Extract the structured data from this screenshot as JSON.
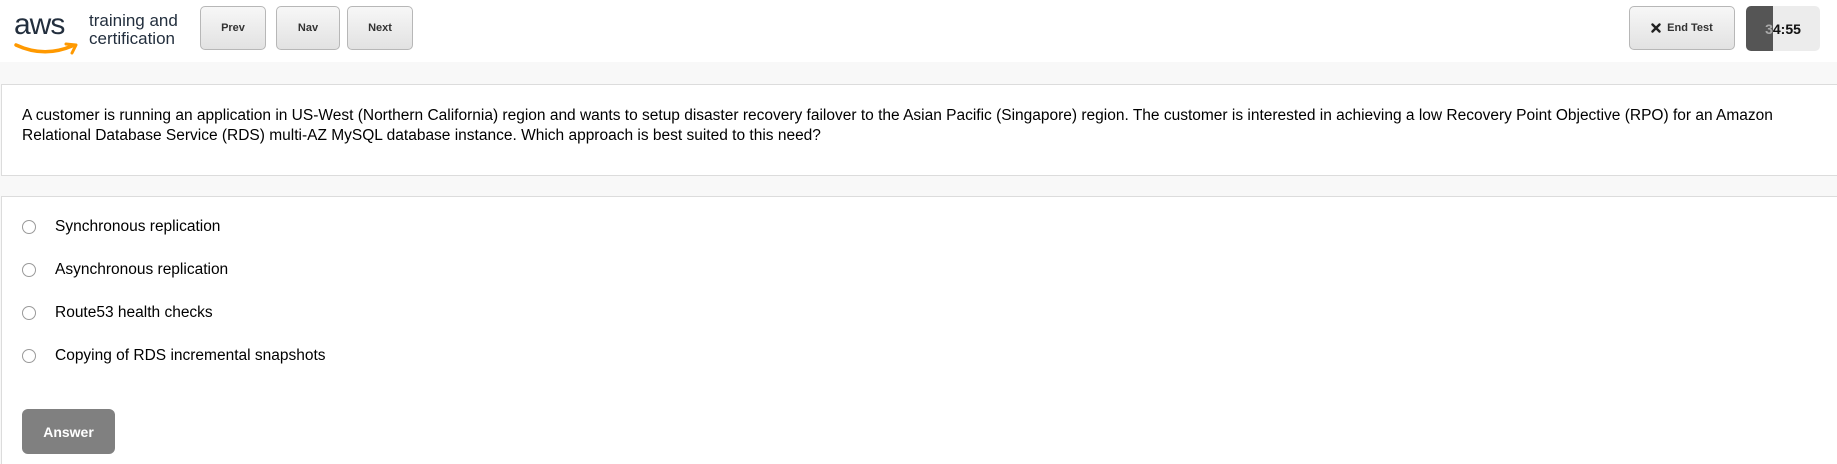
{
  "header": {
    "logo": {
      "brand": "aws",
      "line1": "training and",
      "line2": "certification"
    },
    "prev_label": "Prev",
    "nav_label": "Nav",
    "next_label": "Next",
    "end_test_label": "End Test",
    "timer": {
      "text": "34:55",
      "elapsed_fraction": 0.37
    },
    "colors": {
      "smile": "#ff9900",
      "timer_fill": "#555555",
      "answer_button": "#808080"
    }
  },
  "question": {
    "text": "A customer is running an application in US-West (Northern California) region and wants to setup disaster recovery failover to the Asian Pacific (Singapore) region. The customer is interested in achieving a low Recovery Point Objective (RPO) for an Amazon Relational Database Service (RDS) multi-AZ MySQL database instance. Which approach is best suited to this need?"
  },
  "options": [
    {
      "label": "Synchronous replication"
    },
    {
      "label": "Asynchronous replication"
    },
    {
      "label": "Route53 health checks"
    },
    {
      "label": "Copying of RDS incremental snapshots"
    }
  ],
  "answer_label": "Answer"
}
